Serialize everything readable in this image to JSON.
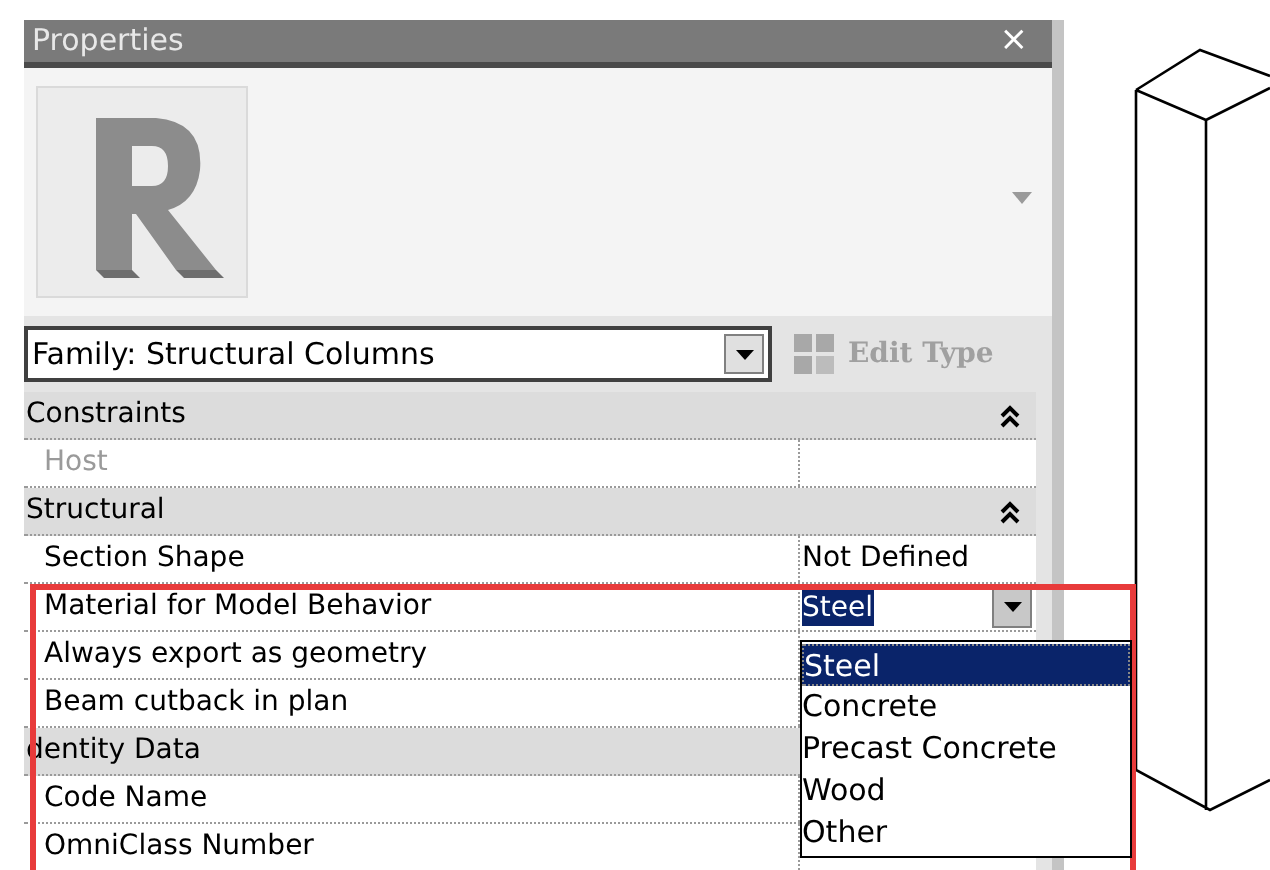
{
  "window": {
    "title": "Properties",
    "close": "×"
  },
  "type_selector": {
    "value": "Family: Structural Columns"
  },
  "edit_type_button": {
    "label": "Edit Type",
    "disabled": true
  },
  "sections": [
    {
      "title": "Constraints",
      "expanded": true,
      "rows": [
        {
          "name": "Host",
          "disabled": true
        }
      ]
    },
    {
      "title": "Structural",
      "expanded": true,
      "rows": [
        {
          "name": "Section Shape",
          "value": "Not Defined"
        },
        {
          "name": "Material for Model Behavior",
          "kind": "dropdown",
          "value": "Steel",
          "open": true,
          "options": [
            {
              "label": "Steel",
              "selected": true
            },
            {
              "label": "Concrete",
              "selected": false
            },
            {
              "label": "Precast Concrete",
              "selected": false
            },
            {
              "label": "Wood",
              "selected": false
            },
            {
              "label": "Other",
              "selected": false
            }
          ]
        },
        {
          "name": "Always export as geometry"
        },
        {
          "name": "Beam cutback in plan"
        }
      ]
    },
    {
      "title": "dentity Data",
      "rows": [
        {
          "name": "Code Name"
        },
        {
          "name": "OmniClass Number"
        }
      ]
    }
  ]
}
